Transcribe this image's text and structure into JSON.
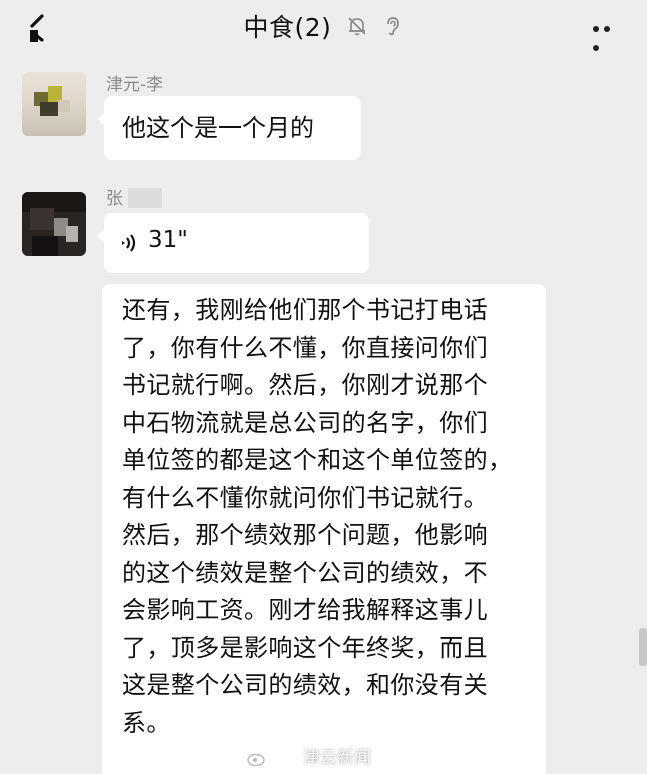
{
  "header": {
    "title": "中食(2)",
    "icons": [
      "back-icon",
      "mute-bell-icon",
      "ear-icon",
      "more-icon"
    ]
  },
  "messages": [
    {
      "sender": "津元-李",
      "type": "text",
      "text": "他这个是一个月的"
    },
    {
      "sender": "张",
      "type": "voice",
      "duration": "31\""
    },
    {
      "type": "text",
      "text": "还有，我刚给他们那个书记打电话\n了，你有什么不懂，你直接问你们\n书记就行啊。然后，你刚才说那个\n中石物流就是总公司的名字，你们\n单位签的都是这个和这个单位签的，\n有什么不懂你就问你们书记就行。\n然后，那个绩效那个问题，他影响\n的这个绩效是整个公司的绩效，不\n会影响工资。刚才给我解释这事儿\n了，顶多是影响这个年终奖，而且\n这是整个公司的绩效，和你没有关\n系。"
    }
  ],
  "watermark": {
    "text": "津云新闻"
  },
  "colors": {
    "background": "#ededed",
    "bubble": "#ffffff",
    "sender": "#8a8a8a"
  }
}
